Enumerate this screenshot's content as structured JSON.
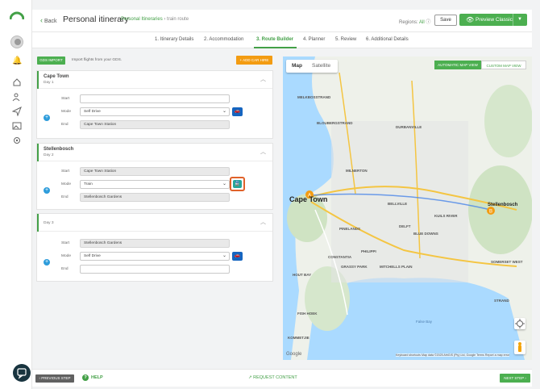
{
  "header": {
    "back_label": "Back",
    "title": "Personal itinerary",
    "breadcrumb_link": "Personal Itineraries",
    "breadcrumb_sep": "›",
    "breadcrumb_current": "train route",
    "regions_label": "Regions:",
    "regions_value": "All",
    "save_label": "Save",
    "preview_label": "Preview Classic"
  },
  "steps": [
    {
      "label": "1. Itinerary Details",
      "active": false
    },
    {
      "label": "2. Accommodation",
      "active": false
    },
    {
      "label": "3. Route Builder",
      "active": true
    },
    {
      "label": "4. Planner",
      "active": false
    },
    {
      "label": "5. Review",
      "active": false
    },
    {
      "label": "6. Additional Details",
      "active": false
    }
  ],
  "toolbar": {
    "gds_import_label": "GDS IMPORT",
    "gds_hint": "Import flights from your GDS.",
    "add_car_label": "+ ADD CAR HIRE"
  },
  "routes": [
    {
      "city": "Cape Town",
      "day": "Day 1",
      "start_label": "Start",
      "start_value": "",
      "mode_label": "Mode",
      "mode_value": "Self Drive",
      "end_label": "End",
      "end_value": "Cape Town Station",
      "mode_icon": "car-icon"
    },
    {
      "city": "Stellenbosch",
      "day": "Day 2",
      "start_label": "Start",
      "start_value": "Cape Town Station",
      "mode_label": "Mode",
      "mode_value": "Train",
      "end_label": "End",
      "end_value": "Stellenbosch Gardens",
      "mode_icon": "train-icon"
    },
    {
      "city": "",
      "day": "Day 3",
      "start_label": "Start",
      "start_value": "Stellenbosch Gardens",
      "mode_label": "Mode",
      "mode_value": "Self Drive",
      "end_label": "End",
      "end_value": "",
      "mode_icon": "car-icon"
    }
  ],
  "map": {
    "tab_map": "Map",
    "tab_satellite": "Satellite",
    "auto_view_label": "AUTOMATIC MAP VIEW",
    "custom_view_label": "CUSTOM MAP VIEW",
    "labels": [
      "MELKBOSSTRAND",
      "DURBANVILLE",
      "BLOUBERGSTRAND",
      "MILNERTON",
      "Cape Town",
      "BELLVILLE",
      "Stellenbosch",
      "BLUE DOWNS",
      "PHILIPPI",
      "MITCHELLS PLAIN",
      "GRASSY PARK",
      "FISH HOEK",
      "KUILS RIVER",
      "DELFT",
      "PINELANDS",
      "CONSTANTIA",
      "HOUT BAY",
      "KOMMETJIE",
      "SOMERSET WEST",
      "STRAND",
      "False Bay"
    ],
    "markers": [
      "A",
      "B"
    ],
    "attribution": "Keyboard shortcuts   Map data ©2025 AfriGIS (Pty) Ltd, Google   Terms   Report a map error",
    "google_logo": "Google"
  },
  "footer": {
    "prev_label": "PREVIOUS STEP",
    "help_label": "HELP",
    "request_label": "REQUEST CONTENT",
    "next_label": "NEXT STEP"
  }
}
